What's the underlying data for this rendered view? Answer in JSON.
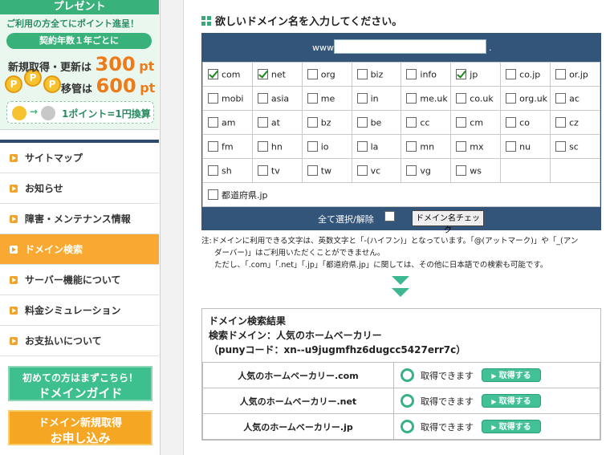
{
  "sidebar": {
    "promo": {
      "banner_top": "プレゼント",
      "line1": "ご利用の方全てにポイント進呈！",
      "pill": "契約年数１年ごとに",
      "row1_label": "新規取得・更新は",
      "row1_value": "300",
      "row1_unit": "pt",
      "row2_label": "移管は",
      "row2_value": "600",
      "row2_unit": "pt",
      "coin_letter": "P",
      "foot_text": "1ポイント=1円換算"
    },
    "nav": [
      {
        "label": "サイトマップ",
        "active": false
      },
      {
        "label": "お知らせ",
        "active": false
      },
      {
        "label": "障害・メンテナンス情報",
        "active": false
      },
      {
        "label": "ドメイン検索",
        "active": true
      },
      {
        "label": "サーバー機能について",
        "active": false
      },
      {
        "label": "料金シミュレーション",
        "active": false
      },
      {
        "label": "お支払いについて",
        "active": false
      }
    ],
    "guide_button": {
      "line1": "初めての方はまずこちら！",
      "line2": "ドメインガイド"
    },
    "apply_button": {
      "line1": "ドメイン新規取得",
      "line2": "お申し込み"
    }
  },
  "main": {
    "heading": "欲しいドメイン名を入力してください。",
    "search": {
      "www_label": "www.",
      "input_value": "",
      "dot_label": ".",
      "tlds": [
        [
          {
            "label": "com",
            "checked": true
          },
          {
            "label": "net",
            "checked": true
          },
          {
            "label": "org",
            "checked": false
          },
          {
            "label": "biz",
            "checked": false
          },
          {
            "label": "info",
            "checked": false
          },
          {
            "label": "jp",
            "checked": true
          },
          {
            "label": "co.jp",
            "checked": false
          },
          {
            "label": "or.jp",
            "checked": false
          }
        ],
        [
          {
            "label": "mobi",
            "checked": false
          },
          {
            "label": "asia",
            "checked": false
          },
          {
            "label": "me",
            "checked": false
          },
          {
            "label": "in",
            "checked": false
          },
          {
            "label": "me.uk",
            "checked": false
          },
          {
            "label": "co.uk",
            "checked": false
          },
          {
            "label": "org.uk",
            "checked": false
          },
          {
            "label": "ac",
            "checked": false
          }
        ],
        [
          {
            "label": "am",
            "checked": false
          },
          {
            "label": "at",
            "checked": false
          },
          {
            "label": "bz",
            "checked": false
          },
          {
            "label": "be",
            "checked": false
          },
          {
            "label": "cc",
            "checked": false
          },
          {
            "label": "cm",
            "checked": false
          },
          {
            "label": "co",
            "checked": false
          },
          {
            "label": "cz",
            "checked": false
          }
        ],
        [
          {
            "label": "fm",
            "checked": false
          },
          {
            "label": "hn",
            "checked": false
          },
          {
            "label": "io",
            "checked": false
          },
          {
            "label": "la",
            "checked": false
          },
          {
            "label": "mn",
            "checked": false
          },
          {
            "label": "mx",
            "checked": false
          },
          {
            "label": "nu",
            "checked": false
          },
          {
            "label": "sc",
            "checked": false
          }
        ],
        [
          {
            "label": "sh",
            "checked": false
          },
          {
            "label": "tv",
            "checked": false
          },
          {
            "label": "tw",
            "checked": false
          },
          {
            "label": "vc",
            "checked": false
          },
          {
            "label": "vg",
            "checked": false
          },
          {
            "label": "ws",
            "checked": false
          },
          null,
          null
        ]
      ],
      "prefecture_label": "都道府県.jp",
      "select_all_label": "全て選択/解除",
      "check_button": "ドメイン名チェック"
    },
    "note": {
      "line1": "注:ドメインに利用できる文字は、英数文字と「-(ハイフン)」となっています。「@(アットマーク)」や「_(アン",
      "line2": "ダーバー)」はご利用いただくことができません。",
      "line3": "ただし、「.com」「.net」「.jp」「都道府県.jp」に関しては、その他に日本語での検索も可能です。"
    },
    "results": {
      "title": "ドメイン検索結果",
      "search_domain": "検索ドメイン：人気のホームベーカリー",
      "punycode": "（punyコード：xn--u9jugmfhz6dugcc5427err7c）",
      "rows": [
        {
          "name": "人気のホームベーカリー.com",
          "status": "取得できます",
          "button": "取得する"
        },
        {
          "name": "人気のホームベーカリー.net",
          "status": "取得できます",
          "button": "取得する"
        },
        {
          "name": "人気のホームベーカリー.jp",
          "status": "取得できます",
          "button": "取得する"
        }
      ]
    }
  },
  "colors": {
    "nav_active": "#f9a932",
    "panel": "#34557a",
    "accent_green": "#3db892"
  }
}
